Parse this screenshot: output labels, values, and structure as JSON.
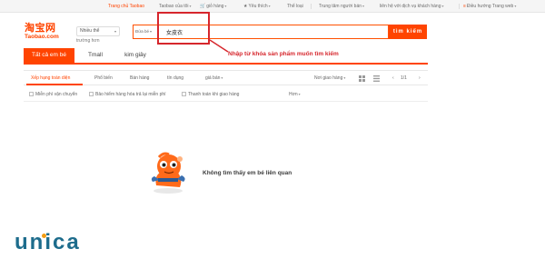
{
  "topbar": {
    "home": "Trang chủ Taobao",
    "my_taobao": "Taobao của tôi",
    "cart": "giỏ hàng",
    "favorites": "Yêu thích",
    "categories": "Thể loại",
    "seller_center": "Trung tâm người bán",
    "contact": "liên hệ với dịch vụ khách hàng",
    "navigate": "Điều hướng Trang web"
  },
  "logo": {
    "cn": "淘宝网",
    "en": "Taobao.com"
  },
  "category_select": {
    "value": "Nhiều thể",
    "sub_label": "trường hơn"
  },
  "search": {
    "scope_label": "Đứa bé",
    "query": "女皮衣",
    "button_label": "tìm kiếm"
  },
  "annotation": {
    "text": "Nhập từ khóa sản phẩm muốn tìm kiếm",
    "color": "#d6262c"
  },
  "tabs": [
    {
      "label": "Tất cả em bé",
      "active": true
    },
    {
      "label": "Tmall",
      "active": false
    },
    {
      "label": "kim giây",
      "active": false
    }
  ],
  "sort": {
    "options": [
      "Xếp hạng toàn diện",
      "Phổ biến",
      "Bán hàng",
      "tín dụng",
      "giá bán"
    ],
    "shipping": "Nơi giao hàng",
    "pager": "1/1"
  },
  "filters": {
    "items": [
      "Miễn phí vận chuyển",
      "Bảo hiểm hàng hóa trả lại miễn phí",
      "Thanh toán khi giao hàng"
    ],
    "more": "Hơn"
  },
  "empty_state": {
    "message": "Không tìm thấy em bé liên quan"
  },
  "watermark": {
    "brand": "unica"
  },
  "colors": {
    "accent": "#ff4400",
    "annotation": "#d6262c",
    "brand": "#1d6c8c"
  }
}
